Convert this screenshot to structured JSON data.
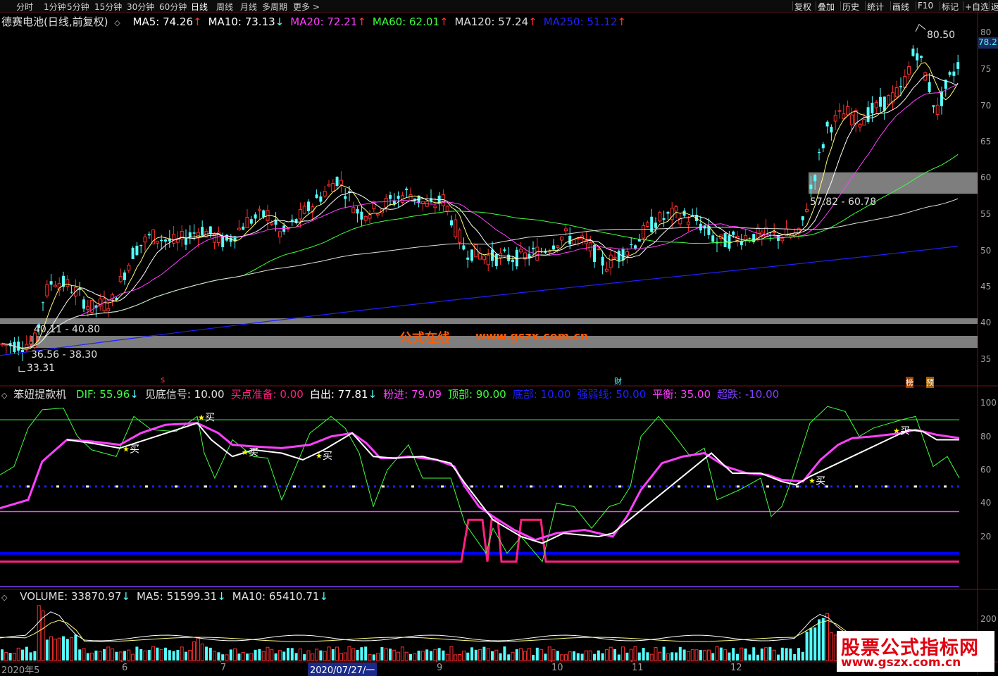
{
  "toolbar": {
    "periods": [
      "分时",
      "1分钟",
      "5分钟",
      "15分钟",
      "30分钟",
      "60分钟",
      "日线",
      "周线",
      "月线",
      "多周期",
      "更多 >"
    ],
    "active_period": "日线",
    "right_buttons": [
      "复权",
      "叠加",
      "历史",
      "统计",
      "画线",
      "F10",
      "标记",
      "+自选",
      "返"
    ]
  },
  "main_panel": {
    "title": "德赛电池(日线,前复权)",
    "ma": [
      {
        "label": "MA5: 74.26",
        "arrow": "↑",
        "color": "#ffffff"
      },
      {
        "label": "MA10: 73.13",
        "arrow": "↓",
        "color": "#ffffff"
      },
      {
        "label": "MA20: 72.21",
        "arrow": "↑",
        "color": "#ff40ff"
      },
      {
        "label": "MA60: 62.01",
        "arrow": "↑",
        "color": "#40ff40"
      },
      {
        "label": "MA120: 57.24",
        "arrow": "↑",
        "color": "#e0e0e0"
      },
      {
        "label": "MA250: 51.12",
        "arrow": "↑",
        "color": "#2020ff"
      }
    ],
    "price_labels": {
      "high": "80.50",
      "low": "33.31",
      "zone_top": "57.82 - 60.78",
      "zone_mid": "40.11 - 40.80",
      "zone_low": "36.56 - 38.30"
    },
    "current_price_tag": "78.2",
    "y_ticks": [
      "80",
      "75",
      "70",
      "65",
      "60",
      "55",
      "50",
      "45",
      "40",
      "35"
    ],
    "event_markers": [
      "财",
      "榜",
      "预"
    ]
  },
  "indicator_panel": {
    "name": "笨妞提款机",
    "items": [
      {
        "label": "DIF: 55.96",
        "arrow": "↓",
        "color": "#40ff40"
      },
      {
        "label": "见底信号: 10.00",
        "arrow": "",
        "color": "#e0e0e0"
      },
      {
        "label": "买点准备: 0.00",
        "arrow": "",
        "color": "#ff2080"
      },
      {
        "label": "白出: 77.81",
        "arrow": "↓",
        "color": "#ffffff"
      },
      {
        "label": "粉进: 79.09",
        "arrow": "",
        "color": "#ff40ff"
      },
      {
        "label": "顶部: 90.00",
        "arrow": "",
        "color": "#40ff40"
      },
      {
        "label": "底部: 10.00",
        "arrow": "",
        "color": "#2020ff"
      },
      {
        "label": "强弱线: 50.00",
        "arrow": "",
        "color": "#2020ff"
      },
      {
        "label": "平衡: 35.00",
        "arrow": "",
        "color": "#ff40ff"
      },
      {
        "label": "超跌: -10.00",
        "arrow": "",
        "color": "#8040ff"
      }
    ],
    "buy_label": "买",
    "y_ticks": [
      "100",
      "80",
      "60",
      "40",
      "20"
    ]
  },
  "volume_panel": {
    "items": [
      {
        "label": "VOLUME: 33870.97",
        "arrow": "↓",
        "color": "#e0e0e0"
      },
      {
        "label": "MA5: 51599.31",
        "arrow": "↓",
        "color": "#e0e0e0"
      },
      {
        "label": "MA10: 65410.71",
        "arrow": "↓",
        "color": "#e0e0e0"
      }
    ],
    "y_tick": "200"
  },
  "date_axis": {
    "labels": [
      "2020年5",
      "6",
      "7",
      "9",
      "10",
      "11",
      "12"
    ],
    "highlight": "2020/07/27/一"
  },
  "watermarks": {
    "center_cn": "公式在线",
    "center_url": "www.gszx.com.cn",
    "brand_cn": "股票公式指标网",
    "brand_url": "www.gszx.com.cn"
  },
  "colors": {
    "up": "#ff3030",
    "down": "#54ffff",
    "zone": "#8c8c8c",
    "watermark": "#ff5a00"
  }
}
